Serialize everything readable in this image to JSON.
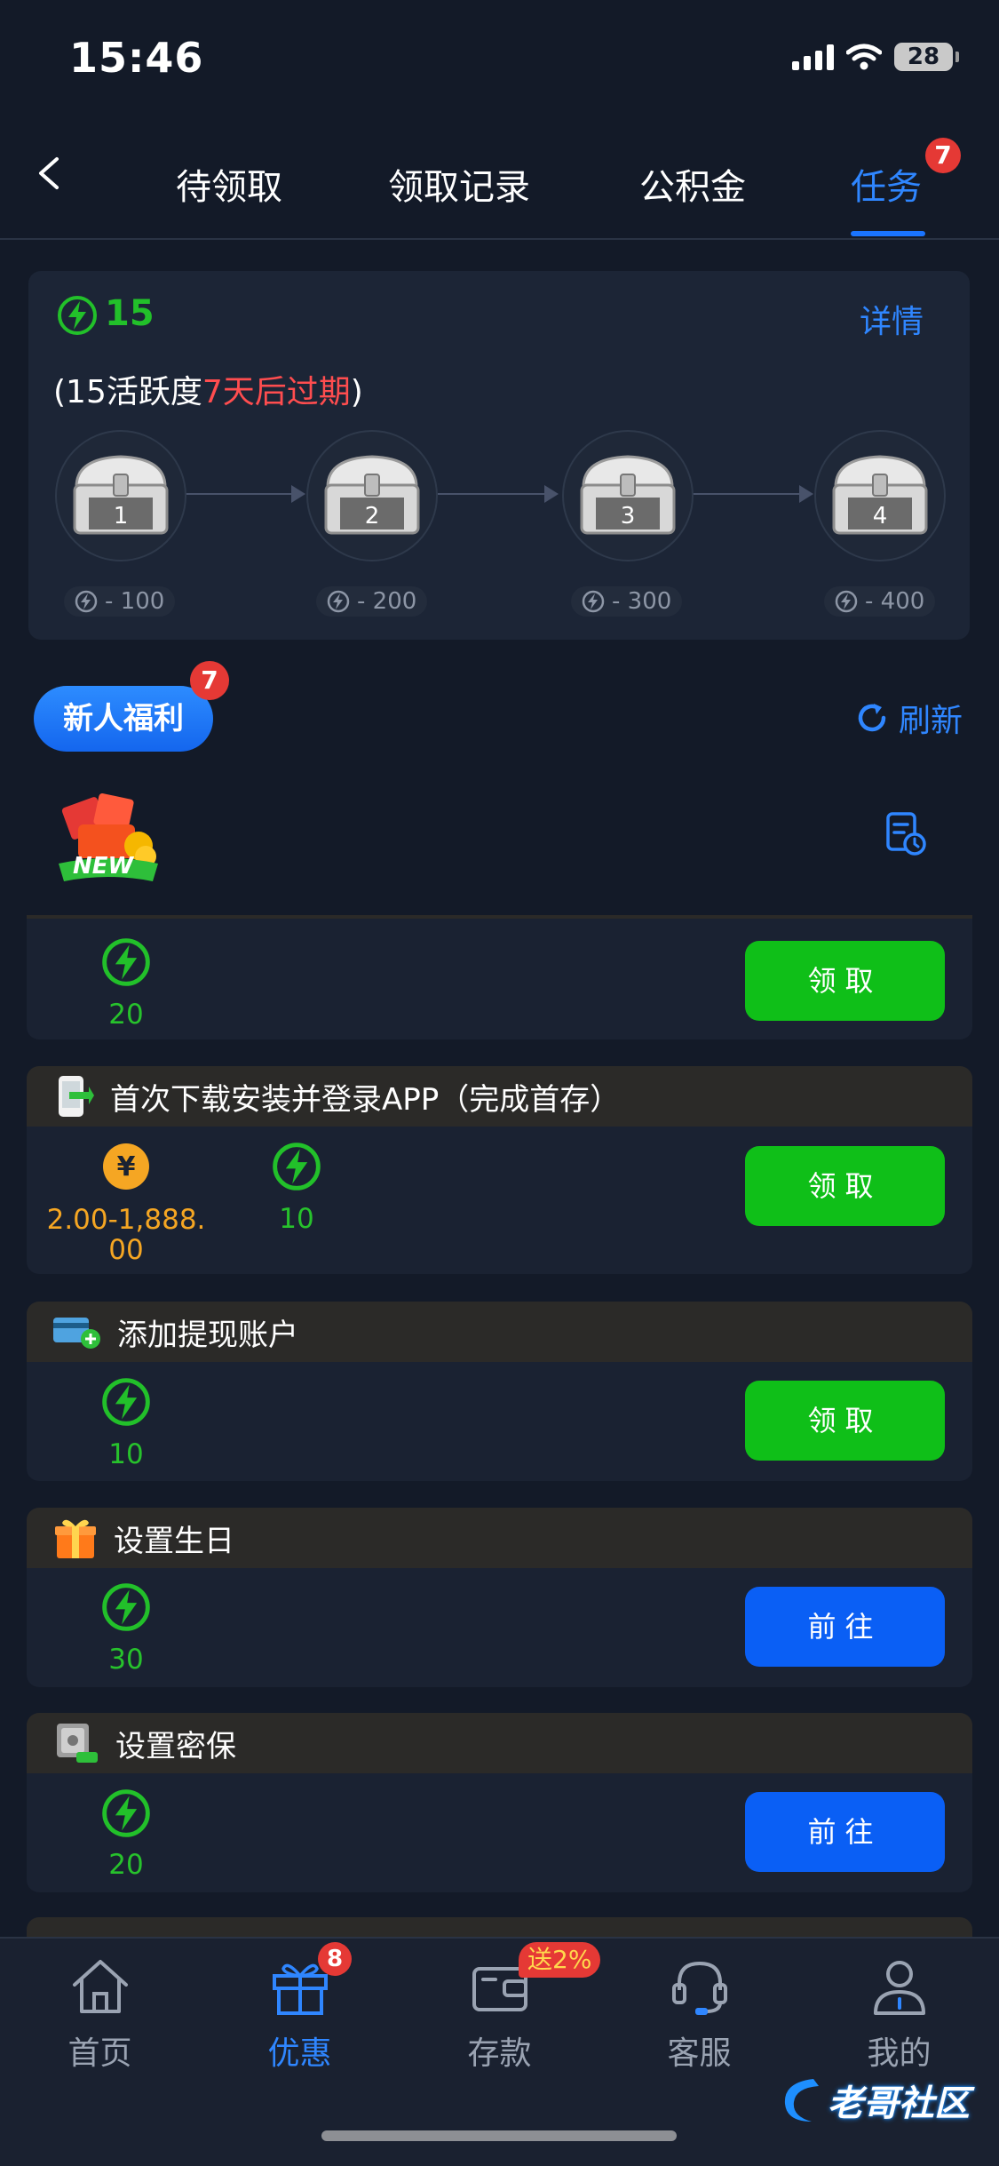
{
  "status_bar": {
    "time": "15:46",
    "battery": "28"
  },
  "header": {
    "tabs": [
      {
        "label": "待领取"
      },
      {
        "label": "领取记录"
      },
      {
        "label": "公积金"
      },
      {
        "label": "任务",
        "badge": "7"
      }
    ],
    "active_tab": 3
  },
  "activity": {
    "points": "15",
    "detail_label": "详情",
    "expiry_prefix": "(15活跃度",
    "expiry_highlight": "7天后过期",
    "expiry_suffix": ")",
    "chests": [
      {
        "number": "1",
        "cost": "- 100"
      },
      {
        "number": "2",
        "cost": "- 200"
      },
      {
        "number": "3",
        "cost": "- 300"
      },
      {
        "number": "4",
        "cost": "- 400"
      }
    ]
  },
  "section": {
    "title": "新人福利",
    "badge": "7",
    "refresh_label": "刷新",
    "new_tag": "NEW"
  },
  "tasks": [
    {
      "title": "",
      "rewards": [
        {
          "type": "energy",
          "value": "20"
        }
      ],
      "button": "领取",
      "button_type": "claim"
    },
    {
      "title": "首次下载安装并登录APP（完成首存）",
      "icon": "phone-download-icon",
      "rewards": [
        {
          "type": "coin",
          "value": "2.00-1,888.00"
        },
        {
          "type": "energy",
          "value": "10"
        }
      ],
      "button": "领取",
      "button_type": "claim"
    },
    {
      "title": "添加提现账户",
      "icon": "card-add-icon",
      "rewards": [
        {
          "type": "energy",
          "value": "10"
        }
      ],
      "button": "领取",
      "button_type": "claim"
    },
    {
      "title": "设置生日",
      "icon": "gift-icon",
      "rewards": [
        {
          "type": "energy",
          "value": "30"
        }
      ],
      "button": "前往",
      "button_type": "go"
    },
    {
      "title": "设置密保",
      "icon": "safe-icon",
      "rewards": [
        {
          "type": "energy",
          "value": "20"
        }
      ],
      "button": "前往",
      "button_type": "go"
    }
  ],
  "bottom_nav": {
    "items": [
      {
        "label": "首页",
        "icon": "home-icon"
      },
      {
        "label": "优惠",
        "icon": "gift-box-icon",
        "badge": "8"
      },
      {
        "label": "存款",
        "icon": "wallet-icon",
        "badge": "送2%"
      },
      {
        "label": "客服",
        "icon": "headset-icon"
      },
      {
        "label": "我的",
        "icon": "user-icon"
      }
    ],
    "active": 1
  },
  "watermark": "老哥社区",
  "colors": {
    "accent": "#1a74ff",
    "green": "#0fbf18",
    "highlight_red": "#ff4d4f",
    "coin": "#f5a623"
  }
}
